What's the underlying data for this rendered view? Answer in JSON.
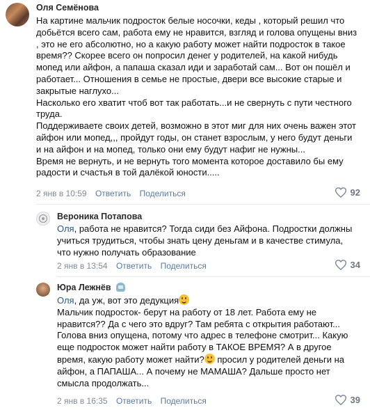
{
  "comments": [
    {
      "author": "Оля Семёнова",
      "paragraphs": [
        "На картине мальчик подросток белые носочки, кеды , который решил что добьётся всего сам, работа ему не нравится, взгляд и голова опущены вниз , это не его абсолютно, но а какую работу может найти подросток в такое время?? Скорее всего он попросил денег у родителей, на какой нибудь мопед или айфон, а папаша сказал иди и заработай сам... Вот он пошёл и работает... Отношения в семье не простые, двери все высокие старые и закрытые наглухо...",
        "Насколько его хватит чтоб вот так работать...и не свернуть с пути честного труда.",
        "Поддерживаете своих детей, возможно в этот миг для них очень важен этот айфон или мопед,,, пройдут годы, он станет взрослым, у него будут деньги и на айфон и на мопед, только они ему будут нафиг не нужны...",
        "Время не вернуть, и не вернуть того момента которое доставило бы ему радости и счастья в той далёкой юности....."
      ],
      "date": "2 янв в 10:59",
      "reply_label": "Ответить",
      "share_label": "Поделиться",
      "likes": "92"
    },
    {
      "author": "Вероника Потапова",
      "reply_to": "Оля",
      "text": ", работа не нравится? Тогда сиди без Айфона. Подростки должны учиться трудиться, чтобы знать цену деньгам и в качестве стимула, что нужно получать образование",
      "date": "2 янв в 13:54",
      "reply_label": "Ответить",
      "share_label": "Поделиться",
      "likes": "34"
    },
    {
      "author": "Юра Лежнёв",
      "reply_to": "Оля",
      "text_a": ", да уж, вот это дедукция",
      "text_b": "Мальчик подросток- берут на работу от 18 лет. Работа ему не нравится?? Да с чего это вдруг? Там ребята с открытия работают... Голова вниз опущена, потому что адрес в телефоне смотрит... Какую еще подросток может найти работу в ТАКОЕ ВРЕМЯ? А в другое время, какую работу может найти?",
      "text_c": " просил у родителей деньги на айфон, а ПАПАША... А почему не МАМАША? Дальше просто нет смысла продолжать...",
      "date": "2 янв в 16:35",
      "reply_label": "Ответить",
      "share_label": "Поделиться",
      "likes": "39"
    }
  ],
  "colors": {
    "link": "#2a5885",
    "meta": "#818c99",
    "action": "#5b7ba3",
    "divider": "#e7e8ec"
  },
  "icons": [
    "heart-icon",
    "smile-emoji",
    "mask-emoji"
  ]
}
